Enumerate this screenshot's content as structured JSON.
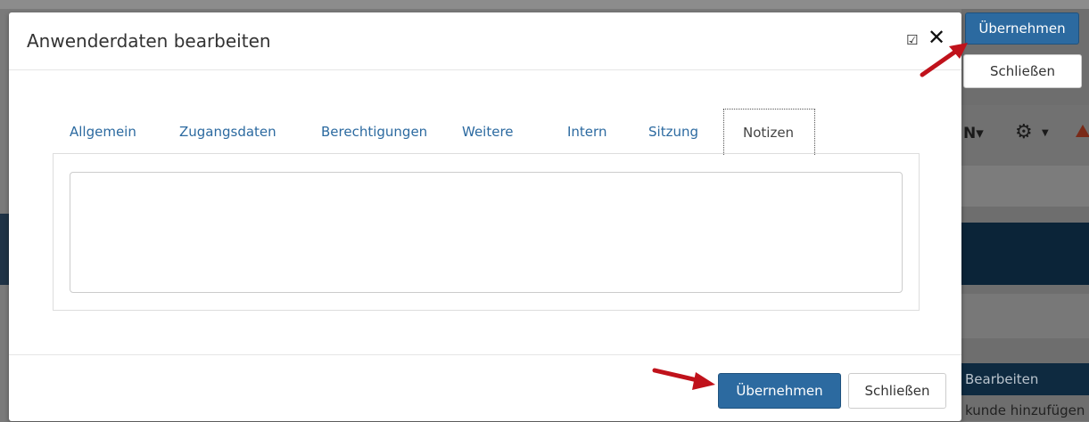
{
  "modal": {
    "title": "Anwenderdaten bearbeiten",
    "tabs": [
      {
        "label": "Allgemein"
      },
      {
        "label": "Zugangsdaten"
      },
      {
        "label": "Berechtigungen"
      },
      {
        "label": "Weitere"
      },
      {
        "label": "Intern"
      },
      {
        "label": "Sitzung"
      },
      {
        "label": "Notizen",
        "active": true
      }
    ],
    "notes_value": "",
    "apply_label": "Übernehmen",
    "close_label": "Schließen"
  },
  "top_actions": {
    "apply_label": "Übernehmen",
    "close_label": "Schließen"
  },
  "background": {
    "lang_label": "N",
    "edit_label": "Bearbeiten",
    "add_label": "kunde hinzufügen"
  },
  "colors": {
    "primary": "#2c6aa0",
    "navy": "#0b2438",
    "arrow": "#c0121b"
  }
}
